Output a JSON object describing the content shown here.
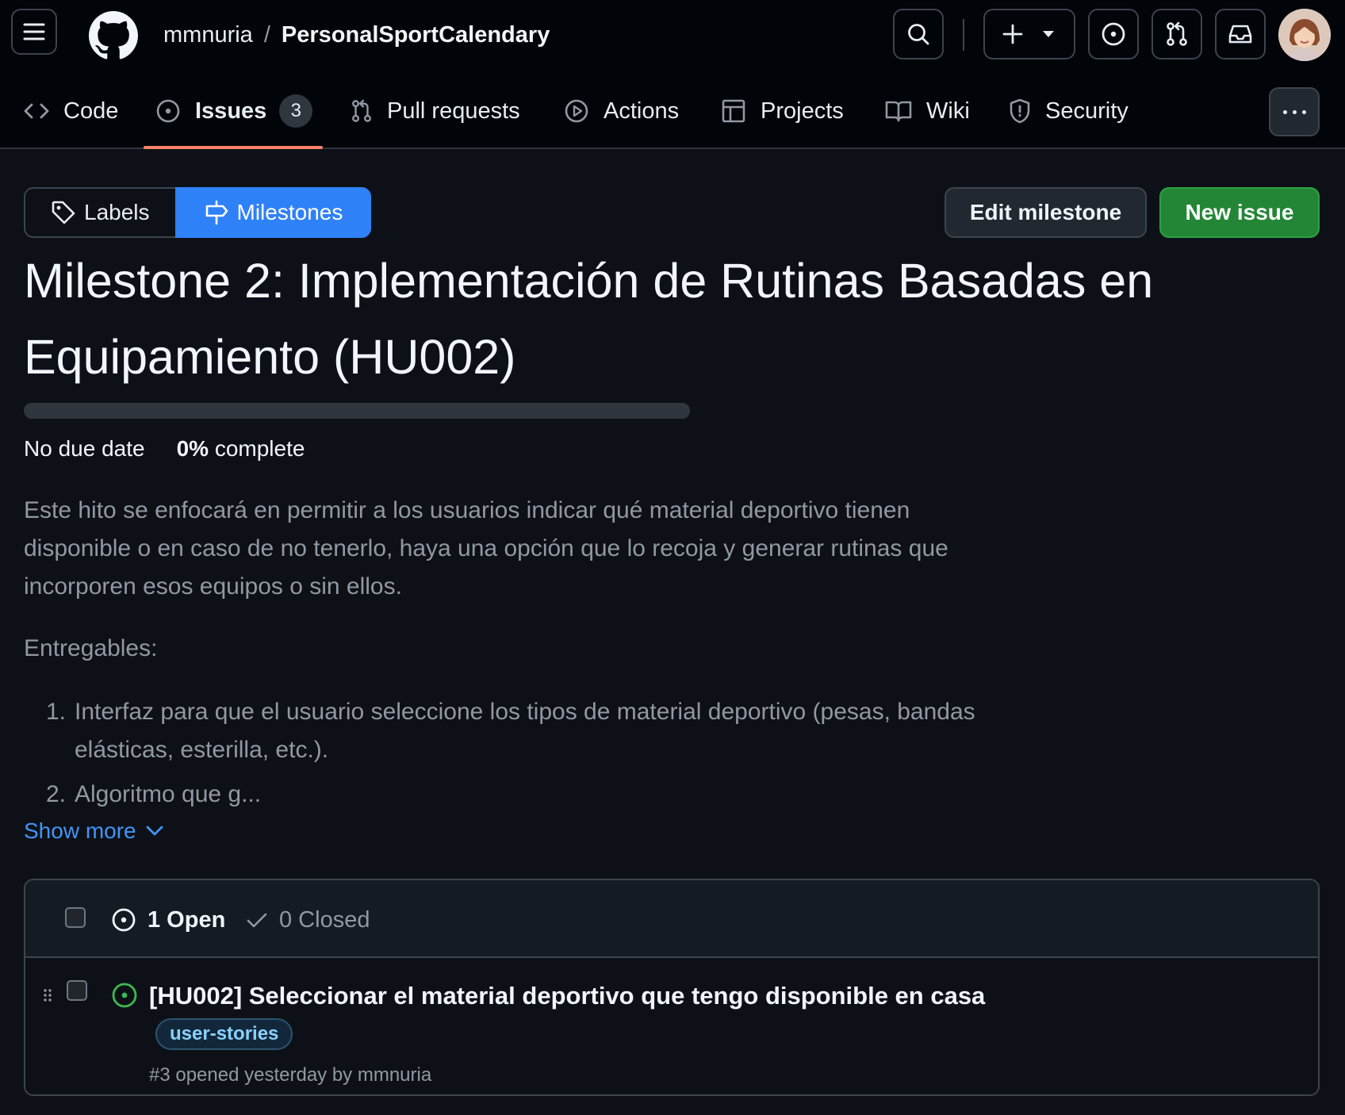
{
  "header": {
    "owner": "mmnuria",
    "separator": "/",
    "repo": "PersonalSportCalendary"
  },
  "tabs": [
    {
      "label": "Code",
      "icon": "code-icon"
    },
    {
      "label": "Issues",
      "icon": "issue-opened-icon",
      "counter": "3",
      "active": true
    },
    {
      "label": "Pull requests",
      "icon": "git-pull-request-icon"
    },
    {
      "label": "Actions",
      "icon": "play-icon"
    },
    {
      "label": "Projects",
      "icon": "table-icon"
    },
    {
      "label": "Wiki",
      "icon": "book-icon"
    },
    {
      "label": "Security",
      "icon": "shield-icon"
    }
  ],
  "subnav": {
    "labels": "Labels",
    "milestones": "Milestones"
  },
  "actions": {
    "edit_milestone": "Edit milestone",
    "new_issue": "New issue"
  },
  "milestone": {
    "title": "Milestone 2: Implementación de Rutinas Basadas en Equipamiento (HU002)",
    "progress_fraction": 0,
    "due": "No due date",
    "percent": "0%",
    "complete_label": "complete",
    "description": "Este hito se enfocará en permitir a los usuarios indicar qué material deportivo tienen disponible o en caso de no tenerlo, haya una opción que lo recoja y generar rutinas que incorporen esos equipos o sin ellos.",
    "deliverables_heading": "Entregables:",
    "deliverables": [
      {
        "num": "1.",
        "text": "Interfaz para que el usuario seleccione los tipos de material deportivo (pesas, bandas elásticas, esterilla, etc.)."
      },
      {
        "num": "2.",
        "text": "Algoritmo que g..."
      }
    ],
    "show_more": "Show more"
  },
  "issues": {
    "open_label": "1 Open",
    "closed_label": "0 Closed",
    "items": [
      {
        "title": "[HU002] Seleccionar el material deportivo que tengo disponible en casa",
        "label": "user-stories",
        "meta": "#3 opened yesterday by mmnuria"
      }
    ]
  },
  "colors": {
    "accent": "#2f81f7",
    "success": "#238636",
    "open_icon": "#3fb950",
    "tab_underline": "#f78166"
  }
}
